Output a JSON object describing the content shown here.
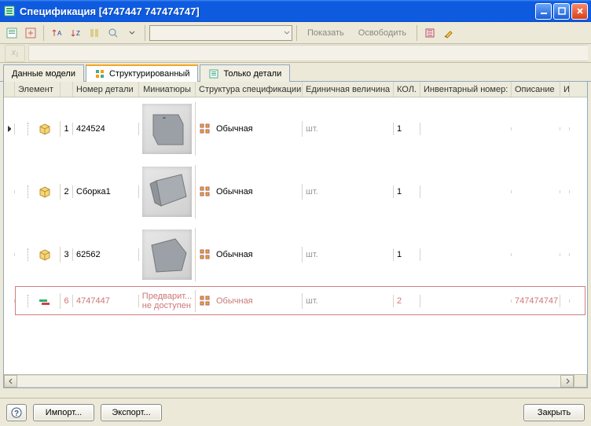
{
  "window": {
    "title": "Спецификация [4747447 747474747]"
  },
  "toolbar": {
    "show_label": "Показать",
    "release_label": "Освободить"
  },
  "fx_label": "x₁",
  "tabs": {
    "model": "Данные модели",
    "structured": "Структурированный",
    "details_only": "Только детали"
  },
  "columns": {
    "element": "Элемент",
    "part_no": "Номер детали",
    "thumb": "Миниатюры",
    "struct": "Структура спецификации",
    "unit": "Единичная величина",
    "qty": "КОЛ.",
    "inventory": "Инвентарный номер:",
    "desc": "Описание",
    "last": "И"
  },
  "struct_label": "Обычная",
  "unit_label": "шт.",
  "rows": [
    {
      "n": "1",
      "part": "424524",
      "qty": "1",
      "inv": "",
      "desc": "",
      "thumb": "solid",
      "highlight": false
    },
    {
      "n": "2",
      "part": "Сборка1",
      "qty": "1",
      "inv": "",
      "desc": "",
      "thumb": "solid",
      "highlight": false
    },
    {
      "n": "3",
      "part": "62562",
      "qty": "1",
      "inv": "",
      "desc": "",
      "thumb": "solid",
      "highlight": false
    },
    {
      "n": "6",
      "part": "4747447",
      "qty": "2",
      "inv": "",
      "desc": "747474747",
      "thumb": "text",
      "thumb_text": "Предварит... не доступен",
      "highlight": true
    }
  ],
  "buttons": {
    "import": "Импорт...",
    "export": "Экспорт...",
    "close": "Закрыть"
  }
}
